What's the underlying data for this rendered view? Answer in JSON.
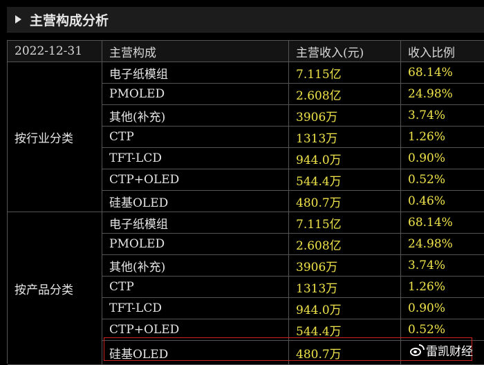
{
  "panel": {
    "title": "主营构成分析"
  },
  "table": {
    "header": {
      "date": "2022-12-31",
      "col_component": "主营构成",
      "col_revenue": "主营收入(元)",
      "col_ratio": "收入比例"
    },
    "groups": [
      {
        "label": "按行业分类",
        "rows": [
          {
            "name": "电子纸模组",
            "revenue": "7.115亿",
            "ratio": "68.14%"
          },
          {
            "name": "PMOLED",
            "revenue": "2.608亿",
            "ratio": "24.98%"
          },
          {
            "name": "其他(补充)",
            "revenue": "3906万",
            "ratio": "3.74%"
          },
          {
            "name": "CTP",
            "revenue": "1313万",
            "ratio": "1.26%"
          },
          {
            "name": "TFT-LCD",
            "revenue": "944.0万",
            "ratio": "0.90%"
          },
          {
            "name": "CTP+OLED",
            "revenue": "544.4万",
            "ratio": "0.52%"
          },
          {
            "name": "硅基OLED",
            "revenue": "480.7万",
            "ratio": "0.46%"
          }
        ]
      },
      {
        "label": "按产品分类",
        "rows": [
          {
            "name": "电子纸模组",
            "revenue": "7.115亿",
            "ratio": "68.14%"
          },
          {
            "name": "PMOLED",
            "revenue": "2.608亿",
            "ratio": "24.98%"
          },
          {
            "name": "其他(补充)",
            "revenue": "3906万",
            "ratio": "3.74%"
          },
          {
            "name": "CTP",
            "revenue": "1313万",
            "ratio": "1.26%"
          },
          {
            "name": "TFT-LCD",
            "revenue": "944.0万",
            "ratio": "0.90%"
          },
          {
            "name": "CTP+OLED",
            "revenue": "544.4万",
            "ratio": "0.52%"
          },
          {
            "name": "硅基OLED",
            "revenue": "480.7万",
            "ratio": ""
          }
        ]
      }
    ]
  },
  "watermark": {
    "text": "雷凯财经",
    "icon": "weibo-icon"
  },
  "colors": {
    "background": "#000000",
    "value_yellow": "#f0e44a",
    "grid": "#555555",
    "highlight": "#d02020"
  }
}
